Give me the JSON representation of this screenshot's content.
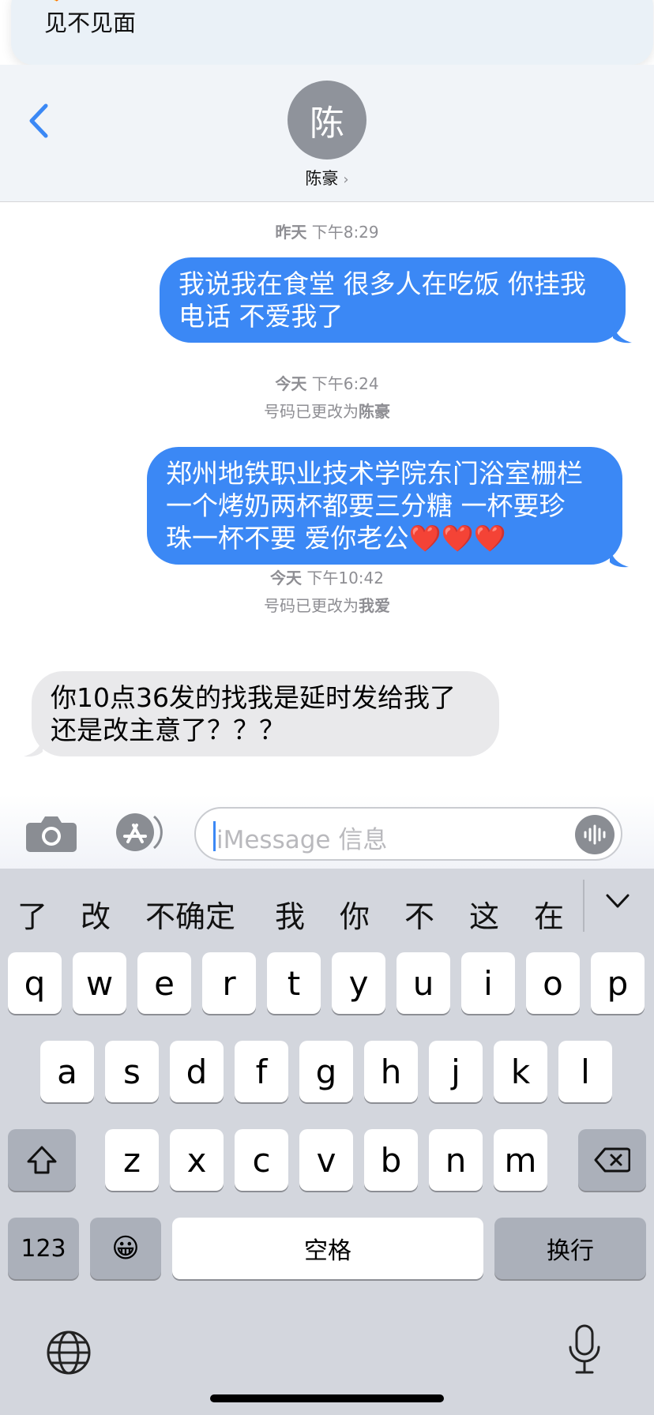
{
  "banner": {
    "text": "见不见面",
    "emoji": "❤️‍🔥"
  },
  "header": {
    "avatar_initial": "陈",
    "contact_name": "陈豪",
    "chevron": "›",
    "back_icon": "chevron-left-icon"
  },
  "thread": {
    "items": [
      {
        "type": "timestamp",
        "day": "昨天",
        "time": "下午8:29"
      },
      {
        "type": "message",
        "direction": "outgoing",
        "lines": [
          "我说我在食堂 很多人在吃饭 你挂我",
          "电话 不爱我了"
        ]
      },
      {
        "type": "timestamp",
        "day": "今天",
        "time": "下午6:24"
      },
      {
        "type": "note",
        "prefix": "号码已更改为",
        "name": "陈豪"
      },
      {
        "type": "message",
        "direction": "outgoing",
        "lines": [
          "郑州地铁职业技术学院东门浴室栅栏",
          "一个烤奶两杯都要三分糖 一杯要珍",
          "珠一杯不要 爱你老公❤️❤️❤️"
        ]
      },
      {
        "type": "timestamp",
        "day": "今天",
        "time": "下午10:42"
      },
      {
        "type": "note",
        "prefix": "号码已更改为",
        "name": "我爱"
      },
      {
        "type": "message",
        "direction": "incoming",
        "lines": [
          "你10点36发的找我是延时发给我了",
          "还是改主意了？？？"
        ]
      }
    ]
  },
  "input": {
    "placeholder": "iMessage 信息",
    "camera_icon": "camera-icon",
    "apps_icon": "app-store-icon",
    "audio_icon": "audio-waveform-icon"
  },
  "keyboard": {
    "candidates": [
      "了",
      "改",
      "不确定",
      "我",
      "你",
      "不",
      "这",
      "在"
    ],
    "row1": [
      "q",
      "w",
      "e",
      "r",
      "t",
      "y",
      "u",
      "i",
      "o",
      "p"
    ],
    "row2": [
      "a",
      "s",
      "d",
      "f",
      "g",
      "h",
      "j",
      "k",
      "l"
    ],
    "row3": [
      "z",
      "x",
      "c",
      "v",
      "b",
      "n",
      "m"
    ],
    "numbers_key": "123",
    "space_key": "空格",
    "return_key": "换行",
    "emoji_key": "😀",
    "colors": {
      "key": "#ffffff",
      "function_key": "#abb0ba",
      "background": "#d3d6dd"
    }
  },
  "colors": {
    "outgoing_bubble": "#3b88f5",
    "incoming_bubble": "#e9e9eb",
    "accent": "#3b88f5"
  }
}
